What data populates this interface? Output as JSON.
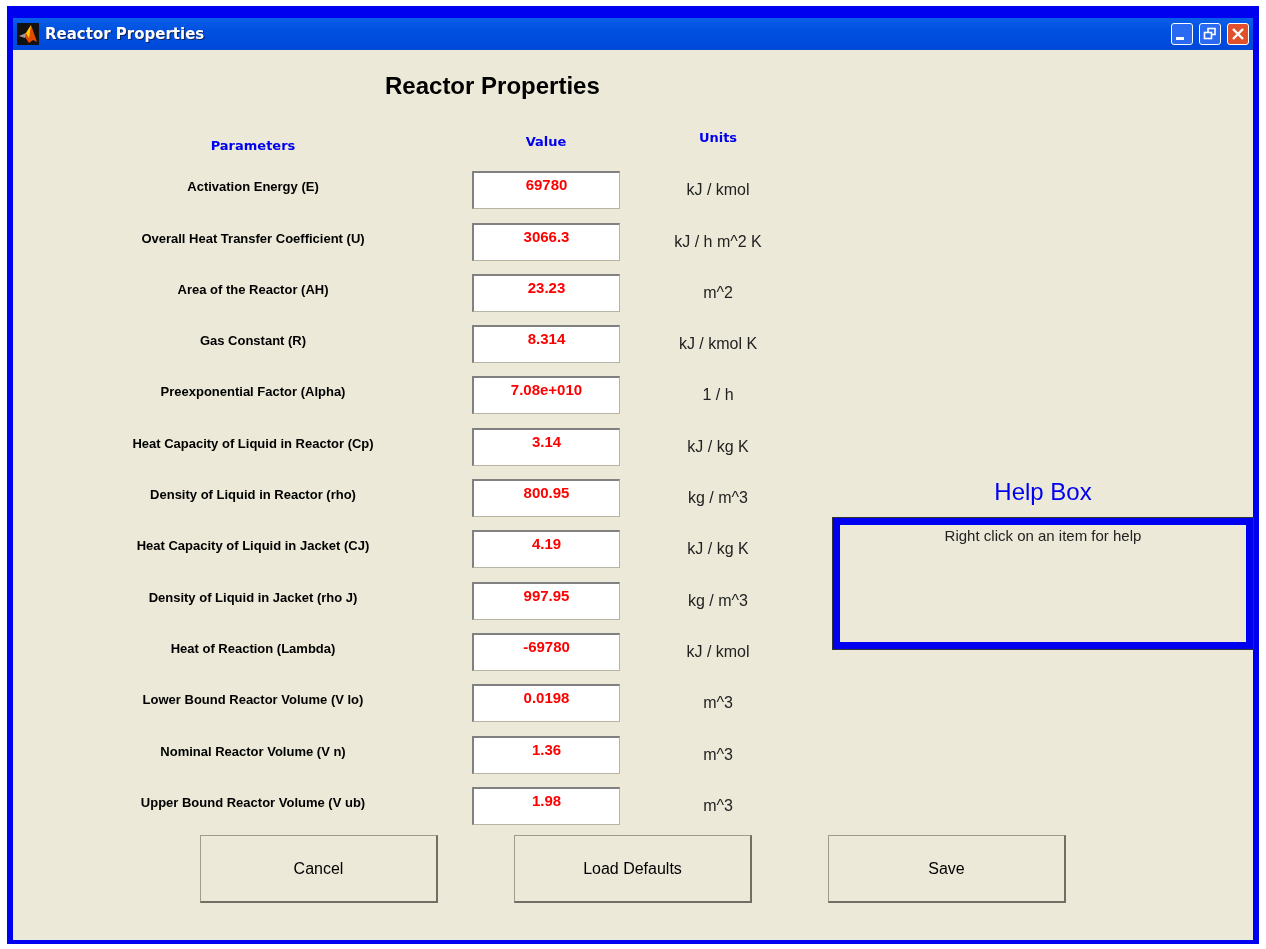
{
  "window": {
    "title": "Reactor Properties"
  },
  "heading": "Reactor Properties",
  "columns": {
    "parameters": "Parameters",
    "value": "Value",
    "units": "Units"
  },
  "parameters": [
    {
      "label": "Activation Energy (E)",
      "value": "69780",
      "units": "kJ / kmol"
    },
    {
      "label": "Overall Heat Transfer Coefficient (U)",
      "value": "3066.3",
      "units": "kJ / h m^2 K"
    },
    {
      "label": "Area of the Reactor (AH)",
      "value": "23.23",
      "units": "m^2"
    },
    {
      "label": "Gas Constant (R)",
      "value": "8.314",
      "units": "kJ / kmol K"
    },
    {
      "label": "Preexponential Factor (Alpha)",
      "value": "7.08e+010",
      "units": "1 / h"
    },
    {
      "label": "Heat Capacity of Liquid in Reactor (Cp)",
      "value": "3.14",
      "units": "kJ / kg K"
    },
    {
      "label": "Density of Liquid in Reactor (rho)",
      "value": "800.95",
      "units": "kg / m^3"
    },
    {
      "label": "Heat Capacity of Liquid in Jacket (CJ)",
      "value": "4.19",
      "units": "kJ / kg K"
    },
    {
      "label": "Density of Liquid in Jacket (rho J)",
      "value": "997.95",
      "units": "kg / m^3"
    },
    {
      "label": "Heat of Reaction (Lambda)",
      "value": "-69780",
      "units": "kJ / kmol"
    },
    {
      "label": "Lower Bound Reactor Volume (V lo)",
      "value": "0.0198",
      "units": "m^3"
    },
    {
      "label": "Nominal Reactor Volume (V n)",
      "value": "1.36",
      "units": "m^3"
    },
    {
      "label": "Upper Bound Reactor Volume (V ub)",
      "value": "1.98",
      "units": "m^3"
    }
  ],
  "help_box": {
    "title": "Help Box",
    "text": "Right click on an item for help"
  },
  "buttons": [
    "Cancel",
    "Load Defaults",
    "Save"
  ]
}
